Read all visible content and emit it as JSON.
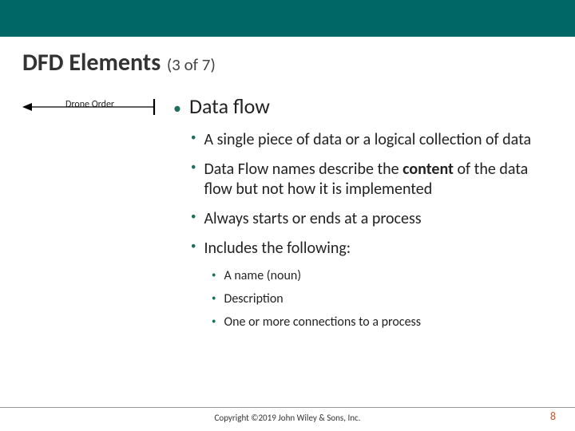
{
  "title": {
    "main": "DFD Elements",
    "sub": "(3 of 7)"
  },
  "diagram": {
    "label": "Drone Order",
    "arrow_color": "#000000",
    "bar_color": "#000000"
  },
  "heading": "Data flow",
  "level2": [
    "A single piece of data or a logical collection of data",
    "Data Flow names describe the __BOLD__content__ENDBOLD__ of the data flow but not how it is implemented",
    "Always starts or ends at a process",
    "Includes the following:"
  ],
  "level3": [
    "A name (noun)",
    "Description",
    "One or more connections to a process"
  ],
  "footer": "Copyright ©2019 John Wiley & Sons, Inc.",
  "page_number": "8"
}
